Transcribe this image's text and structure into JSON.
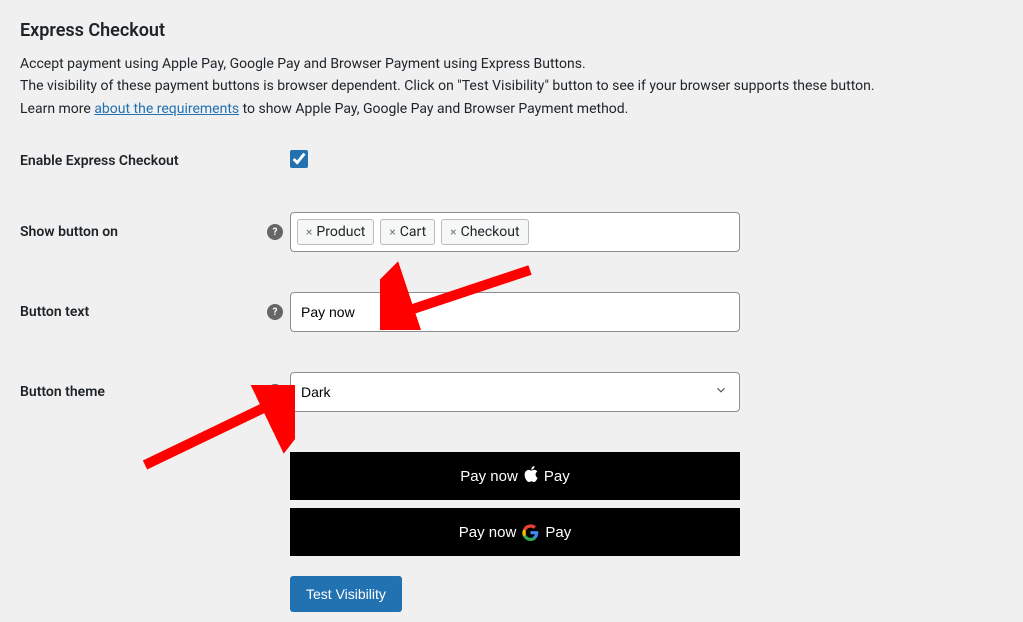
{
  "header": {
    "title": "Express Checkout"
  },
  "intro": {
    "line1": "Accept payment using Apple Pay, Google Pay and Browser Payment using Express Buttons.",
    "line2_before": "The visibility of these payment buttons is browser dependent. Click on \"Test Visibility\" button to see if your browser supports these button.",
    "line3_before": "Learn more ",
    "line3_link": "about the requirements",
    "line3_after": " to show Apple Pay, Google Pay and Browser Payment method."
  },
  "form": {
    "enable_label": "Enable Express Checkout",
    "enable_checked": true,
    "show_button_label": "Show button on",
    "tags": [
      "Product",
      "Cart",
      "Checkout"
    ],
    "button_text_label": "Button text",
    "button_text_value": "Pay now",
    "button_theme_label": "Button theme",
    "button_theme_value": "Dark",
    "test_visibility_label": "Test Visibility"
  },
  "preview": {
    "pay_now_text": "Pay now",
    "apple_pay": "Pay",
    "gpay": "Pay"
  }
}
